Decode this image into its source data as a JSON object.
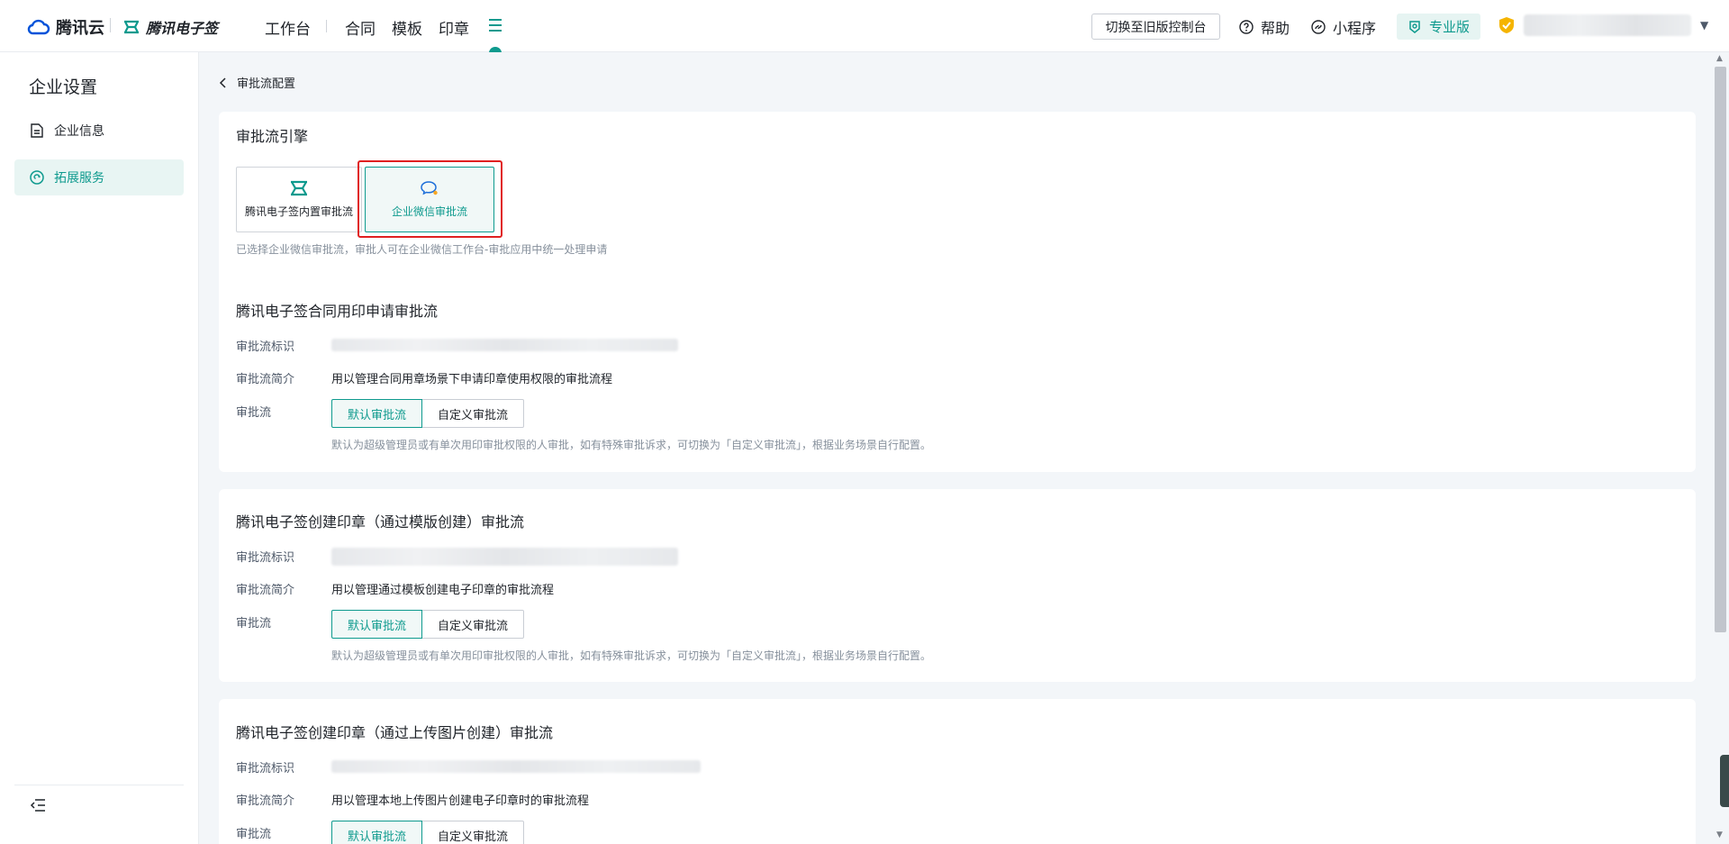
{
  "header": {
    "tencent_cloud": "腾讯云",
    "esign": "腾讯电子签",
    "workbench": "工作台",
    "nav": [
      "合同",
      "模板",
      "印章"
    ],
    "switch_old": "切换至旧版控制台",
    "help": "帮助",
    "miniprogram": "小程序",
    "edition": "专业版"
  },
  "sidebar": {
    "title": "企业设置",
    "items": [
      {
        "label": "企业信息",
        "active": false
      },
      {
        "label": "拓展服务",
        "active": true
      }
    ]
  },
  "breadcrumb": "审批流配置",
  "engine": {
    "title": "审批流引擎",
    "options": [
      {
        "label": "腾讯电子签内置审批流",
        "selected": false
      },
      {
        "label": "企业微信审批流",
        "selected": true
      }
    ],
    "note": "已选择企业微信审批流，审批人可在企业微信工作台-审批应用中统一处理申请"
  },
  "labels": {
    "id": "审批流标识",
    "intro": "审批流简介",
    "flow": "审批流",
    "default_flow": "默认审批流",
    "custom_flow": "自定义审批流",
    "flow_note": "默认为超级管理员或有单次用印审批权限的人审批，如有特殊审批诉求，可切换为「自定义审批流」，根据业务场景自行配置。"
  },
  "flows": [
    {
      "title": "腾讯电子签合同用印申请审批流",
      "intro": "用以管理合同用章场景下申请印章使用权限的审批流程"
    },
    {
      "title": "腾讯电子签创建印章（通过模版创建）审批流",
      "intro": "用以管理通过模板创建电子印章的审批流程"
    },
    {
      "title": "腾讯电子签创建印章（通过上传图片创建）审批流",
      "intro": "用以管理本地上传图片创建电子印章时的审批流程"
    }
  ],
  "colors": {
    "accent": "#0e9a8e",
    "highlight": "#e02020"
  }
}
